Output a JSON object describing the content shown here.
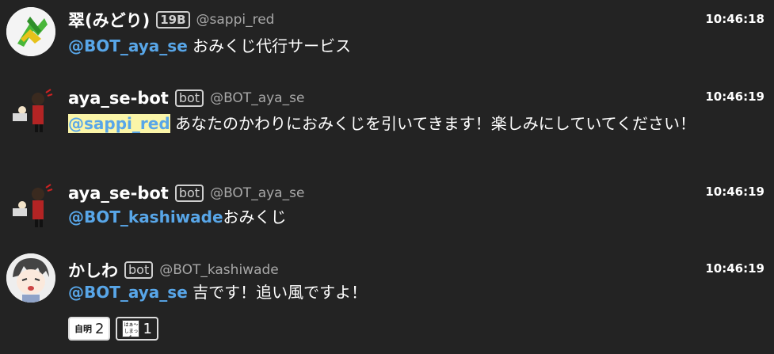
{
  "messages": [
    {
      "name": "翠(みどり)",
      "badge": "19B",
      "handle": "@sappi_red",
      "time": "10:46:18",
      "mention": "@BOT_aya_se",
      "text": " おみくじ代行サービス"
    },
    {
      "name": "aya_se-bot",
      "badge": "bot",
      "handle": "@BOT_aya_se",
      "time": "10:46:19",
      "mention": "@sappi_red",
      "text": " あなたのかわりにおみくじを引いてきます！楽しみにしていてください！"
    },
    {
      "name": "aya_se-bot",
      "badge": "bot",
      "handle": "@BOT_aya_se",
      "time": "10:46:19",
      "mention": "@BOT_kashiwade",
      "text": "おみくじ"
    },
    {
      "name": "かしわ",
      "badge": "bot",
      "handle": "@BOT_kashiwade",
      "time": "10:46:19",
      "mention": "@BOT_aya_se",
      "text": " 吉です！追い風ですよ！"
    }
  ],
  "reactions": [
    {
      "emoji_label": "自明",
      "count": "2"
    },
    {
      "emoji_label": "はぁ〜 しまった",
      "count": "1"
    }
  ],
  "colors": {
    "background": "#232323",
    "mention": "#58a6e8",
    "mention_highlight": "#fbf5a8"
  }
}
